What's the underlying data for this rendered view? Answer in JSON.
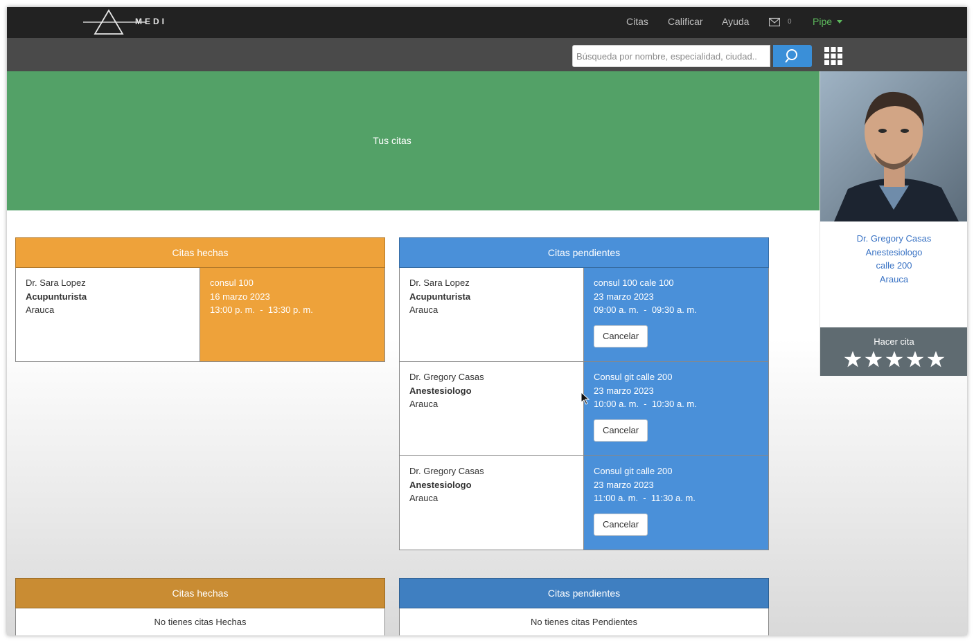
{
  "nav": {
    "brand": "MEDI",
    "items": [
      "Citas",
      "Calificar",
      "Ayuda"
    ],
    "mail_count": "0",
    "user": "Pipe"
  },
  "search": {
    "placeholder": "Búsqueda por nombre, especialidad, ciudad.."
  },
  "hero": {
    "title": "Tus citas"
  },
  "doctor_card": {
    "name": "Dr. Gregory Casas",
    "specialty": "Anestesiologo",
    "address": "calle 200",
    "city": "Arauca",
    "action_label": "Hacer cita",
    "rating": 5
  },
  "done": {
    "title": "Citas hechas",
    "rows": [
      {
        "doctor": "Dr. Sara Lopez",
        "specialty": "Acupunturista",
        "city": "Arauca",
        "place": "consul 100",
        "date": "16 marzo 2023",
        "time": "13:00 p. m.  -  13:30 p. m."
      }
    ]
  },
  "pending": {
    "title": "Citas pendientes",
    "cancel_label": "Cancelar",
    "rows": [
      {
        "doctor": "Dr. Sara Lopez",
        "specialty": "Acupunturista",
        "city": "Arauca",
        "place": "consul 100 cale 100",
        "date": "23 marzo 2023",
        "time": "09:00 a. m.  -  09:30 a. m."
      },
      {
        "doctor": "Dr. Gregory Casas",
        "specialty": "Anestesiologo",
        "city": "Arauca",
        "place": "Consul git calle 200",
        "date": "23 marzo 2023",
        "time": "10:00 a. m.  -  10:30 a. m."
      },
      {
        "doctor": "Dr. Gregory Casas",
        "specialty": "Anestesiologo",
        "city": "Arauca",
        "place": "Consul git calle 200",
        "date": "23 marzo 2023",
        "time": "11:00 a. m.  -  11:30 a. m."
      }
    ]
  },
  "done_empty": {
    "title": "Citas hechas",
    "message": "No tienes citas Hechas"
  },
  "pending_empty": {
    "title": "Citas pendientes",
    "message": "No tienes citas Pendientes"
  },
  "colors": {
    "hero": "#53a167",
    "done": "#eea23a",
    "pending": "#4a90d9",
    "user": "#5cb85c"
  }
}
